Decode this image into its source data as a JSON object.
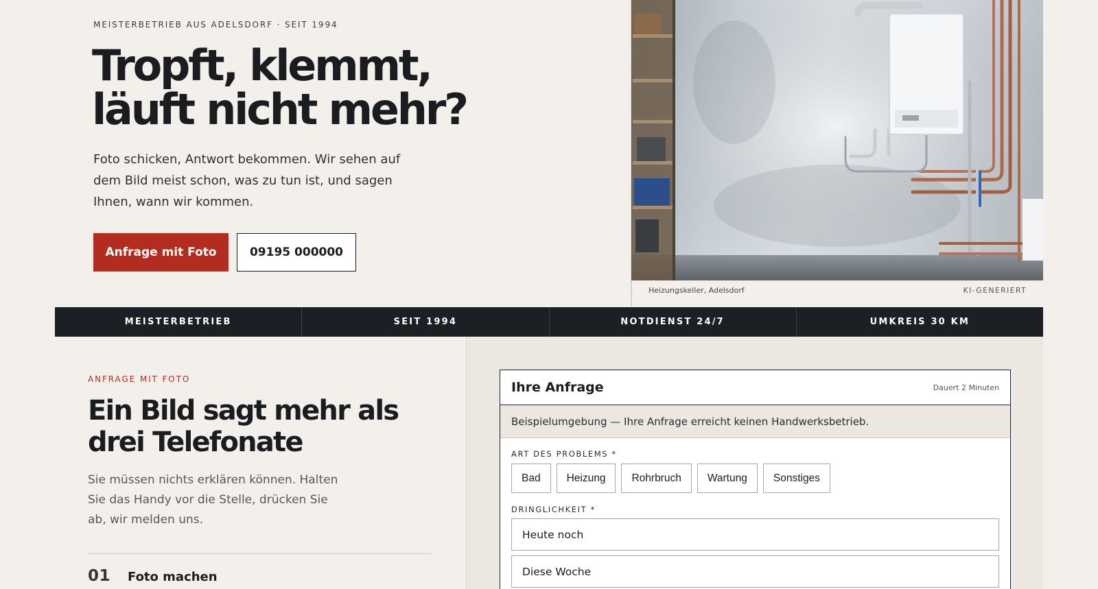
{
  "hero": {
    "eyebrow": "MEISTERBETRIEB AUS ADELSDORF · SEIT 1994",
    "title": "Tropft, klemmt, läuft nicht mehr?",
    "lead": "Foto schicken, Antwort bekommen. Wir sehen auf dem Bild meist schon, was zu tun ist, und sagen Ihnen, wann wir kommen.",
    "primary_button": "Anfrage mit Foto",
    "phone_button": "09195 000000",
    "photo_caption": "Heizungskeller, Adelsdorf",
    "photo_badge": "KI-GENERIERT"
  },
  "stats": [
    "MEISTERBETRIEB",
    "SEIT 1994",
    "NOTDIENST 24/7",
    "UMKREIS 30 KM"
  ],
  "section": {
    "eyebrow": "ANFRAGE MIT FOTO",
    "title": "Ein Bild sagt mehr als drei Telefonate",
    "lead": "Sie müssen nichts erklären können. Halten Sie das Handy vor die Stelle, drücken Sie ab, wir melden uns.",
    "step_number": "01",
    "step_title": "Foto machen"
  },
  "form": {
    "title": "Ihre Anfrage",
    "duration": "Dauert 2 Minuten",
    "notice": "Beispielumgebung — Ihre Anfrage erreicht keinen Handwerksbetrieb.",
    "problem_label": "ART DES PROBLEMS *",
    "problem_options": [
      "Bad",
      "Heizung",
      "Rohrbruch",
      "Wartung",
      "Sonstiges"
    ],
    "urgency_label": "DRINGLICHKEIT *",
    "urgency_options": [
      "Heute noch",
      "Diese Woche"
    ]
  },
  "colors": {
    "accent": "#b22d20",
    "dark": "#1c1f24",
    "page_bg": "#f3f0eb",
    "panel_bg": "#ece8e1"
  }
}
